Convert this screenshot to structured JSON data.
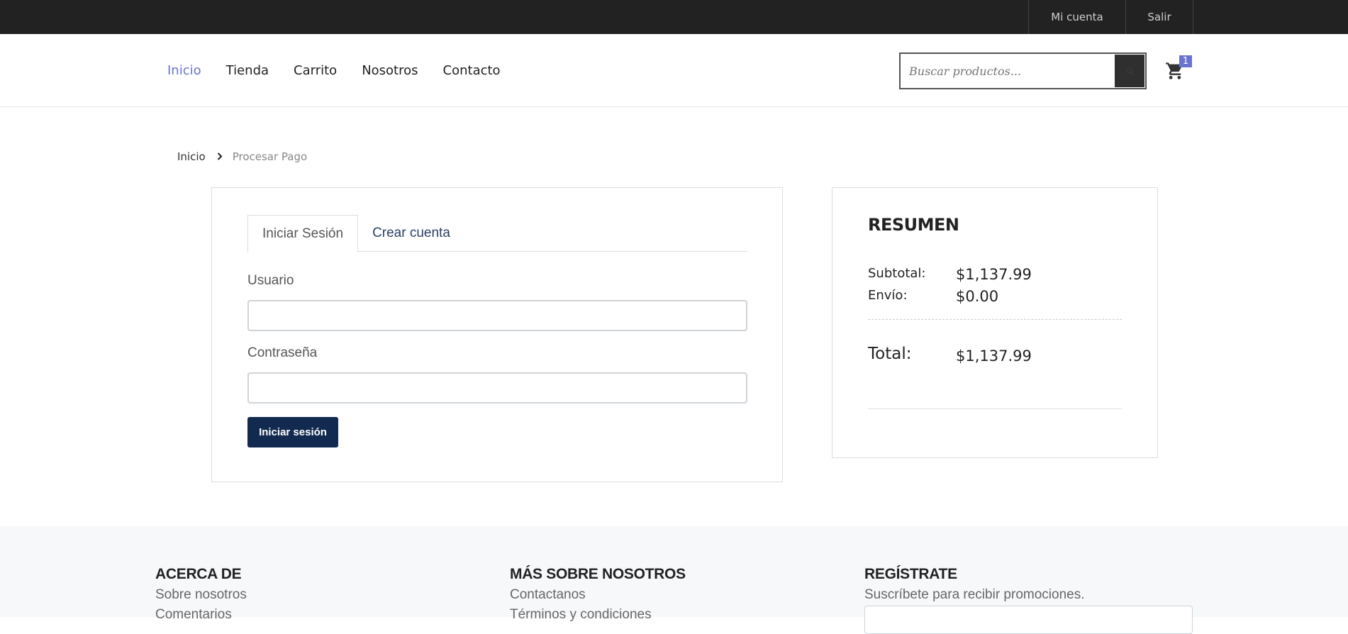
{
  "topbar": {
    "account_label": "Mi cuenta",
    "logout_label": "Salir"
  },
  "nav": {
    "items": [
      "Inicio",
      "Tienda",
      "Carrito",
      "Nosotros",
      "Contacto"
    ],
    "active": "Inicio"
  },
  "search": {
    "placeholder": "Buscar productos..."
  },
  "cart": {
    "count": "1"
  },
  "breadcrumb": {
    "home": "Inicio",
    "current": "Procesar Pago"
  },
  "login": {
    "tabs": [
      "Iniciar Sesión",
      "Crear cuenta"
    ],
    "active_tab": "Iniciar Sesión",
    "username_label": "Usuario",
    "username_value": "",
    "password_label": "Contraseña",
    "password_value": "",
    "submit_label": "Iniciar sesión"
  },
  "summary": {
    "title": "RESUMEN",
    "subtotal_label": "Subtotal:",
    "subtotal_value": "$1,137.99",
    "shipping_label": "Envío:",
    "shipping_value": "$0.00",
    "total_label": "Total:",
    "total_value": "$1,137.99"
  },
  "footer": {
    "about": {
      "title": "ACERCA DE",
      "links": [
        "Sobre nosotros",
        "Comentarios"
      ]
    },
    "more": {
      "title": "MÁS SOBRE NOSOTROS",
      "links": [
        "Contactanos",
        "Términos y condiciones"
      ]
    },
    "register": {
      "title": "REGÍSTRATE",
      "text": "Suscríbete para recibir promociones."
    }
  },
  "colors": {
    "accent": "#6a73d0",
    "topbar": "#222222",
    "button": "#122a50"
  }
}
